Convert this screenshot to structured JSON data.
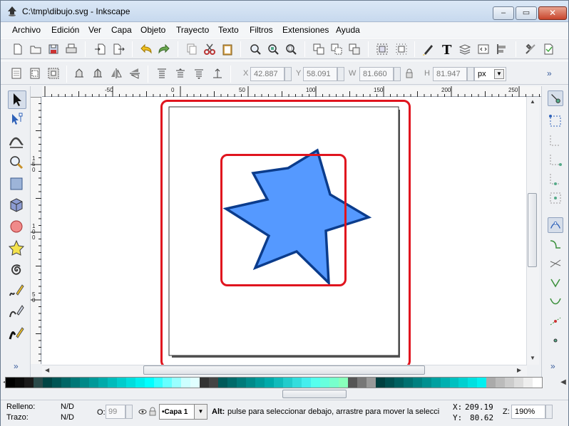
{
  "window": {
    "title": "C:\\tmp\\dibujo.svg - Inkscape",
    "controls": {
      "minimize": "‒",
      "maximize": "▭",
      "close": "✕"
    }
  },
  "menu": [
    "Archivo",
    "Edición",
    "Ver",
    "Capa",
    "Objeto",
    "Trayecto",
    "Texto",
    "Filtros",
    "Extensiones",
    "Ayuda"
  ],
  "toolbar_main": {
    "icons": [
      "new-document-icon",
      "open-icon",
      "save-icon",
      "print-icon",
      "import-icon",
      "export-icon",
      "undo-icon",
      "redo-icon",
      "copy-icon",
      "cut-icon",
      "paste-icon",
      "zoom-selection-icon",
      "zoom-drawing-icon",
      "zoom-page-icon",
      "duplicate-icon",
      "clone-icon",
      "unlink-clone-icon",
      "group-icon",
      "ungroup-icon",
      "fill-stroke-icon",
      "text-tool-icon",
      "layers-icon",
      "xml-editor-icon",
      "align-icon",
      "preferences-icon",
      "document-properties-icon"
    ]
  },
  "toolbar_controls": {
    "x_label": "X",
    "x_value": "42.887",
    "y_label": "Y",
    "y_value": "58.091",
    "w_label": "W",
    "w_value": "81.660",
    "h_label": "H",
    "h_value": "81.947",
    "unit": "px",
    "overflow": "»"
  },
  "ruler": {
    "top_ticks": [
      "-50",
      "0",
      "50",
      "100",
      "150",
      "200",
      "250"
    ],
    "left_ticks": [
      "150",
      "100",
      "50"
    ]
  },
  "tools": [
    "selector-tool",
    "node-tool",
    "tweak-tool",
    "zoom-tool",
    "rectangle-tool",
    "3dbox-tool",
    "ellipse-tool",
    "star-tool",
    "spiral-tool",
    "pencil-tool",
    "pen-tool",
    "calligraphy-tool"
  ],
  "status": {
    "fill_label": "Relleno:",
    "fill_value": "N/D",
    "stroke_label": "Trazo:",
    "stroke_value": "N/D",
    "opacity_label": "O:",
    "opacity_value": "99",
    "layer": "•Capa 1",
    "message_bold": "Alt:",
    "message": "pulse para seleccionar debajo, arrastre para mover la selecci",
    "x_label": "X:",
    "x_value": "209.19",
    "y_label": "Y:",
    "y_value": "80.62",
    "zoom_label": "Z:",
    "zoom_value": "190%"
  },
  "colors": {
    "star_fill": "#5599ff",
    "star_stroke": "#0b3c8c",
    "highlight_frame": "#e0141e"
  }
}
